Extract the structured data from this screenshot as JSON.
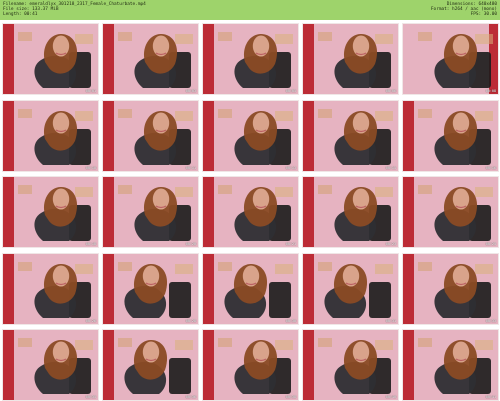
{
  "header": {
    "filename": "Filename: emeraldlyx_301218_2317_Female_Chaturbate.mp4",
    "filesize": "File size: 133.37 MiB",
    "length": "Length: 00:41",
    "dimensions": "Dimensions: 640x480",
    "format": "Format: h264 / aac (mono)",
    "fps": "FPS: 30.00",
    "background_color": "#9ed36b"
  },
  "grid": {
    "columns": 5,
    "rows": 5,
    "thumbnails": [
      {
        "time": "00:01",
        "scene": "wall-pink-left"
      },
      {
        "time": "00:03",
        "scene": "wall-pink-left"
      },
      {
        "time": "00:05",
        "scene": "wall-pink-left"
      },
      {
        "time": "00:06",
        "scene": "wall-pink-left"
      },
      {
        "time": "00:08",
        "scene": "wall-pink-right"
      },
      {
        "time": "00:10",
        "scene": "wall-pink-left"
      },
      {
        "time": "00:11",
        "scene": "wall-pink-left"
      },
      {
        "time": "00:13",
        "scene": "wall-pink-left"
      },
      {
        "time": "00:15",
        "scene": "wall-pink-left"
      },
      {
        "time": "00:16",
        "scene": "wall-pink-left"
      },
      {
        "time": "00:18",
        "scene": "wall-pink-left"
      },
      {
        "time": "00:20",
        "scene": "wall-pink-left"
      },
      {
        "time": "00:21",
        "scene": "wall-pink-left"
      },
      {
        "time": "00:23",
        "scene": "wall-pink-left"
      },
      {
        "time": "00:25",
        "scene": "wall-pink-left"
      },
      {
        "time": "00:26",
        "scene": "wall-pink-left"
      },
      {
        "time": "00:28",
        "scene": "wall-chair"
      },
      {
        "time": "00:30",
        "scene": "wall-chair"
      },
      {
        "time": "00:31",
        "scene": "wall-chair"
      },
      {
        "time": "00:33",
        "scene": "wall-pink-left"
      },
      {
        "time": "00:35",
        "scene": "wall-pink-left"
      },
      {
        "time": "00:36",
        "scene": "wall-chair"
      },
      {
        "time": "00:38",
        "scene": "wall-pink-left"
      },
      {
        "time": "00:40",
        "scene": "wall-pink-left"
      },
      {
        "time": "00:41",
        "scene": "wall-pink-left"
      }
    ]
  }
}
